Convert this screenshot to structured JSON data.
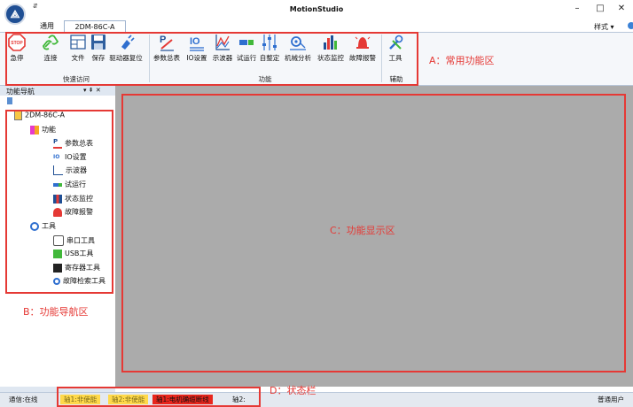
{
  "window": {
    "title": "MotionStudio",
    "minimize": "–",
    "maximize": "□",
    "close": "✕",
    "qat_arrow": "⇵"
  },
  "tabs": {
    "common": "通用",
    "device": "2DM-86C-A",
    "style_menu": "样式 ▾"
  },
  "ribbon": {
    "quick_access": {
      "label": "快速访问",
      "items": [
        "急停",
        "连接",
        "文件",
        "保存",
        "驱动器复位"
      ]
    },
    "function": {
      "label": "功能",
      "items": [
        "参数总表",
        "IO设置",
        "示波器",
        "试运行",
        "自整定",
        "机械分析",
        "状态监控",
        "故障报警"
      ]
    },
    "aux": {
      "label": "辅助",
      "items": [
        "工具"
      ]
    },
    "stop_icon_text": "STOP"
  },
  "nav": {
    "title": "功能导航",
    "pin": "▾ ⇞ ✕",
    "root": "2DM-86C-A",
    "function_group": "功能",
    "function_items": [
      "参数总表",
      "IO设置",
      "示波器",
      "试运行",
      "状态监控",
      "故障报警"
    ],
    "tools_group": "工具",
    "tool_items": [
      "串口工具",
      "USB工具",
      "寄存器工具",
      "故障检索工具"
    ]
  },
  "annotations": {
    "a": "A：常用功能区",
    "b": "B：功能导航区",
    "c": "C：功能显示区",
    "d": "D：状态栏"
  },
  "status": {
    "comm": "通信:在线",
    "axis1": "轴1:非使能",
    "axis2": "轴2:非使能",
    "axis1_err": "轴1:电机确缆断线",
    "axis2_empty": "轴2:",
    "user": "普通用户"
  },
  "colors": {
    "accent": "#1f4f94",
    "annotation": "#e53935",
    "warn_yellow": "#ffd94a",
    "error_red": "#e8261c"
  }
}
